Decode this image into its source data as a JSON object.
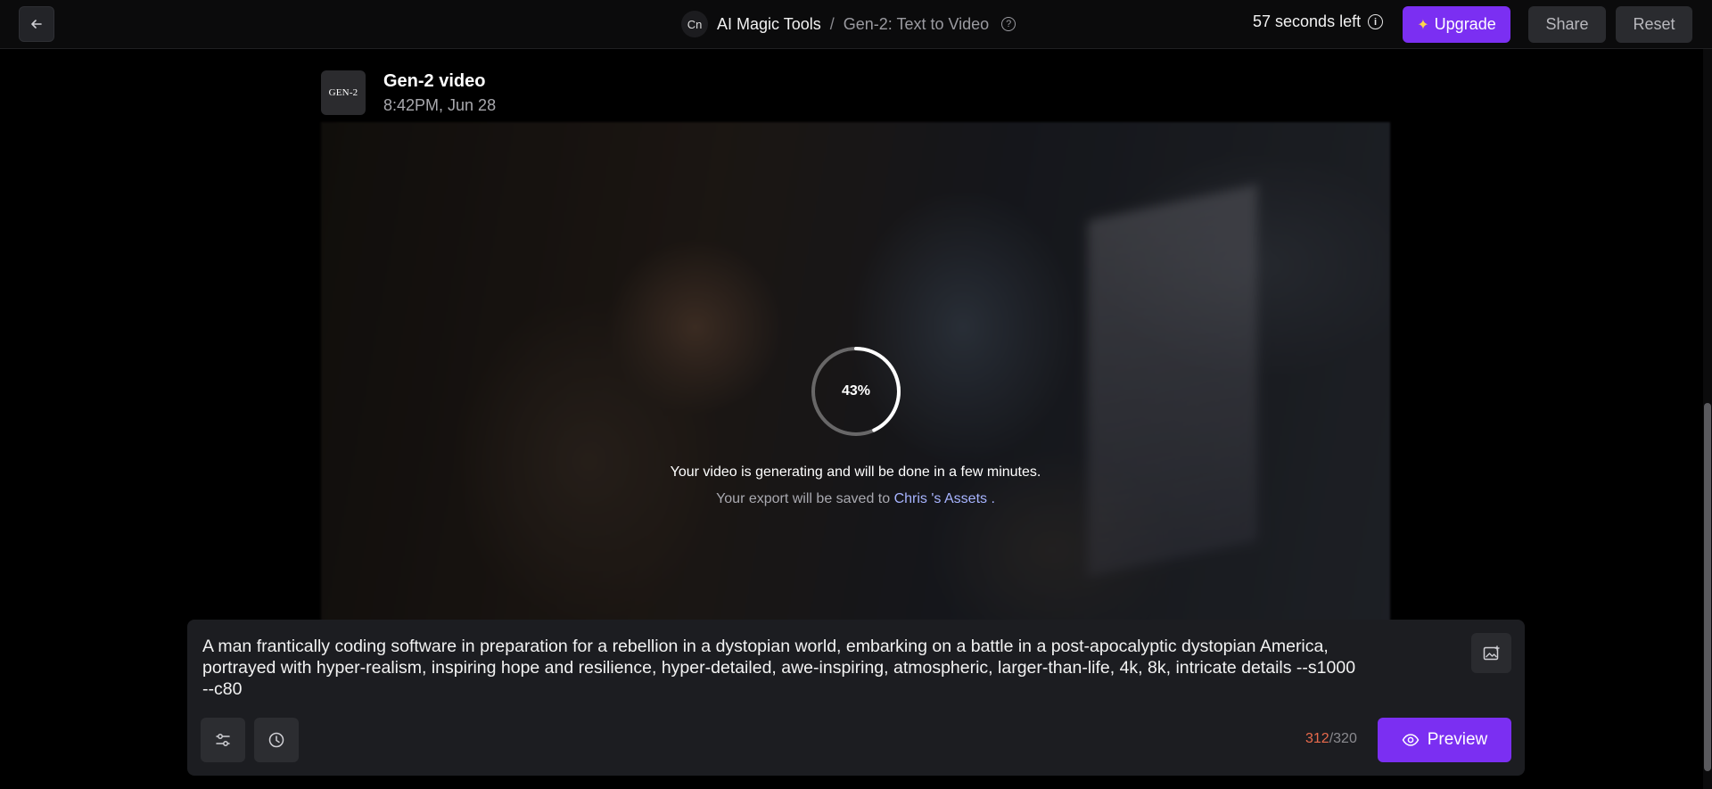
{
  "header": {
    "back_icon": "arrow-left-icon",
    "tool_badge": "Cn",
    "app_name": "AI Magic Tools",
    "separator": "/",
    "page_name": "Gen-2: Text to Video",
    "help_icon": "question-circle-icon",
    "timer_text": "57 seconds left",
    "info_icon": "info-circle-icon",
    "upgrade_label": "Upgrade",
    "share_label": "Share",
    "reset_label": "Reset",
    "accent_color": "#7b2ff2"
  },
  "video": {
    "logo_text": "GEN-2",
    "title": "Gen-2 video",
    "timestamp": "8:42PM, Jun 28",
    "progress_percent": 43,
    "progress_label": "43%",
    "status_message": "Your video is generating and will be done in a few minutes.",
    "export_prefix": "Your export will be saved to",
    "export_link": "Chris 's Assets",
    "export_suffix": "."
  },
  "prompt": {
    "text": "A man frantically coding software in preparation for a rebellion in a dystopian world, embarking on a battle in a post-apocalyptic dystopian America, portrayed with hyper-realism, inspiring hope and resilience, hyper-detailed, awe-inspiring, atmospheric, larger-than-life, 4k, 8k, intricate details --s1000 --c80",
    "image_icon": "image-add-icon",
    "settings_icon": "sliders-icon",
    "history_icon": "clock-icon",
    "char_used": "312",
    "char_limit": "/320",
    "preview_label": "Preview",
    "preview_icon": "eye-icon"
  }
}
